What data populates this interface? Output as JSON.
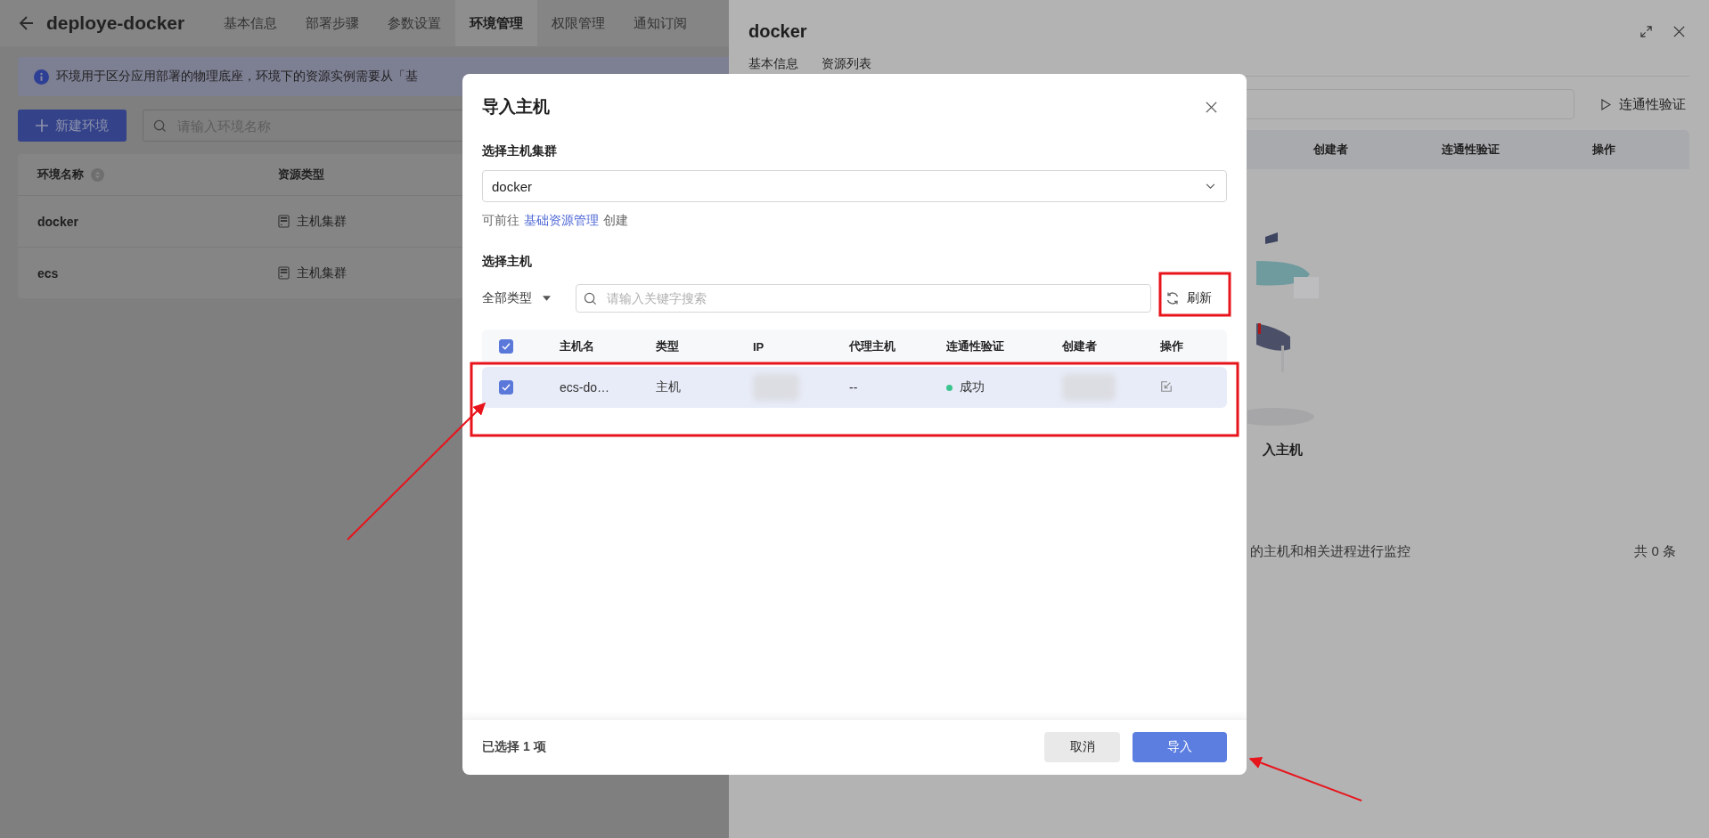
{
  "page": {
    "title": "deploye-docker",
    "tabs": [
      {
        "label": "基本信息",
        "selected": false
      },
      {
        "label": "部署步骤",
        "selected": false
      },
      {
        "label": "参数设置",
        "selected": false
      },
      {
        "label": "环境管理",
        "selected": true
      },
      {
        "label": "权限管理",
        "selected": false
      },
      {
        "label": "通知订阅",
        "selected": false
      }
    ],
    "notice": "环境用于区分应用部署的物理底座，环境下的资源实例需要从「基",
    "new_button": "新建环境",
    "search": {
      "placeholder": "请输入环境名称"
    },
    "table": {
      "columns": [
        "环境名称",
        "资源类型"
      ],
      "rows": [
        {
          "name": "docker",
          "resource_type": "主机集群"
        },
        {
          "name": "ecs",
          "resource_type": "主机集群"
        }
      ]
    }
  },
  "drawer": {
    "title": "docker",
    "tabs": [
      "基本信息",
      "资源列表"
    ],
    "verify_button": "连通性验证",
    "columns": [
      "创建者",
      "连通性验证",
      "操作"
    ],
    "empty_title": "入主机",
    "empty_description": "的主机和相关进程进行监控",
    "total": "共 0 条"
  },
  "modal": {
    "title": "导入主机",
    "cluster_label": "选择主机集群",
    "cluster_value": "docker",
    "hint_before": "可前往",
    "hint_link": "基础资源管理",
    "hint_after": "创建",
    "host_label": "选择主机",
    "type_filter": "全部类型",
    "search": {
      "placeholder": "请输入关键字搜索"
    },
    "refresh": "刷新",
    "table": {
      "all_checked": true,
      "columns": [
        "主机名",
        "类型",
        "IP",
        "代理主机",
        "连通性验证",
        "创建者",
        "操作"
      ],
      "rows": [
        {
          "checked": true,
          "selected": true,
          "host": "ecs-do…",
          "type": "主机",
          "proxy": "--",
          "status": "成功",
          "color": "#3cc48f"
        }
      ]
    },
    "selected_count": "已选择 1 项",
    "cancel": "取消",
    "confirm": "导入"
  }
}
